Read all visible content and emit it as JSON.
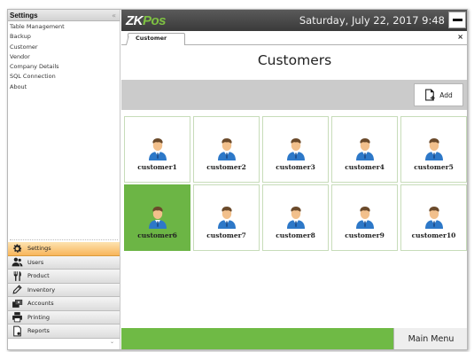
{
  "app": {
    "logo_main": "ZK",
    "logo_accent": "Pos",
    "datetime": "Saturday, July 22, 2017 9:48"
  },
  "sidebar": {
    "title": "Settings",
    "collapse_glyph": "«",
    "items": [
      {
        "label": "Table Management"
      },
      {
        "label": "Backup"
      },
      {
        "label": "Customer"
      },
      {
        "label": "Vendor"
      },
      {
        "label": "Company Details"
      },
      {
        "label": "SQL Connection"
      },
      {
        "label": "About"
      }
    ],
    "nav": [
      {
        "label": "Settings",
        "icon": "gear-icon",
        "active": true
      },
      {
        "label": "Users",
        "icon": "users-icon",
        "active": false
      },
      {
        "label": "Product",
        "icon": "fork-knife-icon",
        "active": false
      },
      {
        "label": "Inventory",
        "icon": "pencil-icon",
        "active": false
      },
      {
        "label": "Accounts",
        "icon": "cash-icon",
        "active": false
      },
      {
        "label": "Printing",
        "icon": "printer-icon",
        "active": false
      },
      {
        "label": "Reports",
        "icon": "report-icon",
        "active": false
      }
    ]
  },
  "tabs": [
    {
      "label": "Customer"
    }
  ],
  "main": {
    "title": "Customers",
    "add_label": "Add",
    "customers": [
      {
        "name": "customer1",
        "selected": false
      },
      {
        "name": "customer2",
        "selected": false
      },
      {
        "name": "customer3",
        "selected": false
      },
      {
        "name": "customer4",
        "selected": false
      },
      {
        "name": "customer5",
        "selected": false
      },
      {
        "name": "customer6",
        "selected": true
      },
      {
        "name": "customer7",
        "selected": false
      },
      {
        "name": "customer8",
        "selected": false
      },
      {
        "name": "customer9",
        "selected": false
      },
      {
        "name": "customer10",
        "selected": false
      }
    ],
    "main_menu_label": "Main Menu"
  },
  "colors": {
    "accent_green": "#6cb545",
    "active_nav": "#f8b55b",
    "topbar": "#4a4a4a",
    "toolbar_gray": "#cbcbcb"
  }
}
